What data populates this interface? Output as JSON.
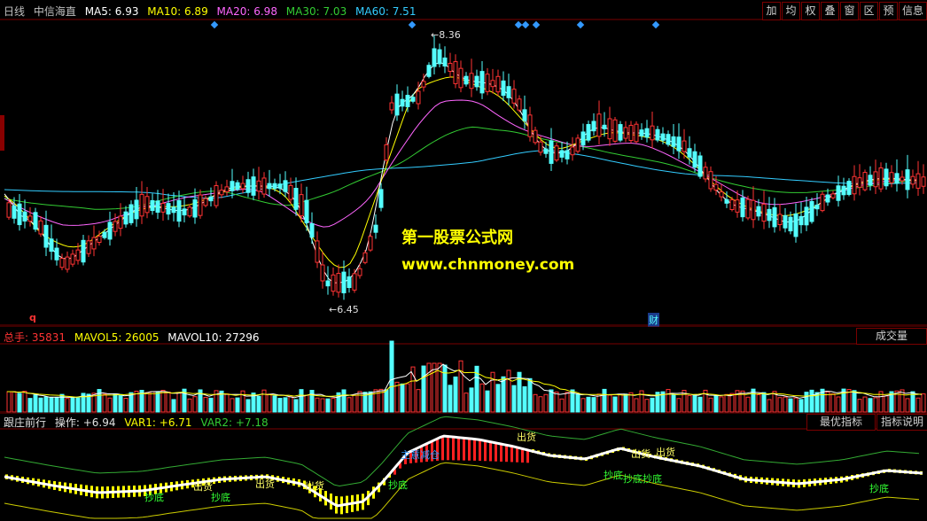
{
  "header": {
    "period": "日线",
    "stock_name": "中信海直",
    "ma": [
      {
        "label": "MA5: 6.93",
        "color": "#ffffff"
      },
      {
        "label": "MA10: 6.89",
        "color": "#ffff00"
      },
      {
        "label": "MA20: 6.98",
        "color": "#ff66ff"
      },
      {
        "label": "MA30: 7.03",
        "color": "#33cc33"
      },
      {
        "label": "MA60: 7.51",
        "color": "#33ccff"
      }
    ]
  },
  "toolbar": {
    "buttons": [
      "加",
      "均",
      "权",
      "叠",
      "窗",
      "区",
      "预",
      "信息"
    ]
  },
  "main_chart": {
    "high_label": "8.36",
    "low_label": "6.45",
    "q_marker": "q",
    "cai_marker": "财"
  },
  "watermark": {
    "line1": "第一股票公式网",
    "line2": "www.chnmoney.com"
  },
  "volume": {
    "total_label": "总手: 35831",
    "mavol5_label": "MAVOL5: 26005",
    "mavol10_label": "MAVOL10: 27296",
    "button": "成交量"
  },
  "indicator": {
    "name": "跟庄前行",
    "op_label": "操作: +6.94",
    "var1_label": "VAR1: +6.71",
    "var2_label": "VAR2: +7.18",
    "btn_best": "最优指标",
    "btn_help": "指标说明",
    "annotations": [
      {
        "text": "抄底",
        "color": "#33ff33"
      },
      {
        "text": "抄底",
        "color": "#33ff33"
      },
      {
        "text": "出货",
        "color": "#ffff66"
      },
      {
        "text": "出货",
        "color": "#ffff66"
      },
      {
        "text": "出货",
        "color": "#ffff66"
      },
      {
        "text": "抄底",
        "color": "#33ff33"
      },
      {
        "text": "主意减仓",
        "color": "#3399ff"
      },
      {
        "text": "出货",
        "color": "#ffff66"
      },
      {
        "text": "抄底",
        "color": "#33ff33"
      },
      {
        "text": "抄底抄底",
        "color": "#33ff33"
      },
      {
        "text": "出货",
        "color": "#ffff66"
      },
      {
        "text": "出货",
        "color": "#ffff66"
      },
      {
        "text": "抄底",
        "color": "#33ff33"
      }
    ]
  },
  "colors": {
    "up": "#ff3333",
    "down": "#54ffff",
    "grid": "#7a0000"
  }
}
